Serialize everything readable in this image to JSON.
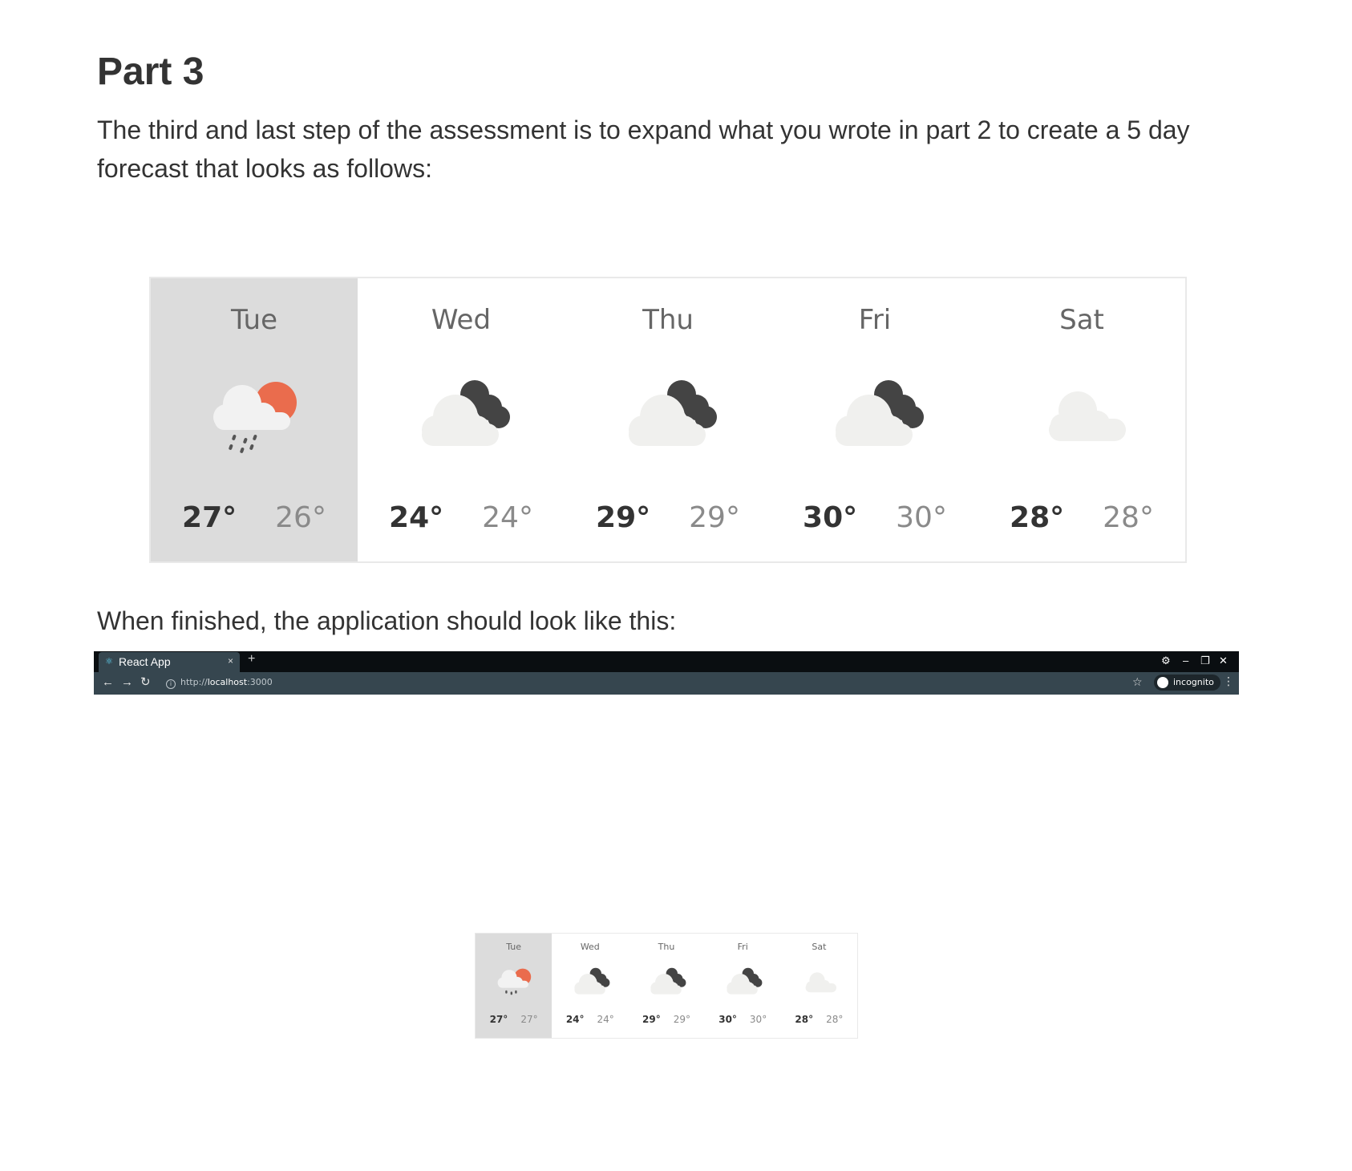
{
  "heading": "Part 3",
  "paragraph1": "The third and last step of the assessment is to expand what you wrote in part 2 to create a 5 day forecast that looks as follows:",
  "paragraph2": "When finished, the application should look like this:",
  "forecast": [
    {
      "day": "Tue",
      "high": "27°",
      "low": "26°",
      "icon": "sun-cloud-rain-icon",
      "selected": true
    },
    {
      "day": "Wed",
      "high": "24°",
      "low": "24°",
      "icon": "dark-cloud-icon",
      "selected": false
    },
    {
      "day": "Thu",
      "high": "29°",
      "low": "29°",
      "icon": "dark-cloud-icon",
      "selected": false
    },
    {
      "day": "Fri",
      "high": "30°",
      "low": "30°",
      "icon": "dark-cloud-icon",
      "selected": false
    },
    {
      "day": "Sat",
      "high": "28°",
      "low": "28°",
      "icon": "cloud-icon",
      "selected": false
    }
  ],
  "browser": {
    "tab_title": "React App",
    "tab_close": "×",
    "new_tab": "+",
    "url_scheme": "http://",
    "url_host": "localhost",
    "url_port": ":3000",
    "incognito_label": "incognito"
  },
  "small_forecast": [
    {
      "day": "Tue",
      "high": "27°",
      "low": "27°",
      "icon": "sun-cloud-rain-icon",
      "selected": true
    },
    {
      "day": "Wed",
      "high": "24°",
      "low": "24°",
      "icon": "dark-cloud-icon",
      "selected": false
    },
    {
      "day": "Thu",
      "high": "29°",
      "low": "29°",
      "icon": "dark-cloud-icon",
      "selected": false
    },
    {
      "day": "Fri",
      "high": "30°",
      "low": "30°",
      "icon": "dark-cloud-icon",
      "selected": false
    },
    {
      "day": "Sat",
      "high": "28°",
      "low": "28°",
      "icon": "cloud-icon",
      "selected": false
    }
  ],
  "colors": {
    "sun": "#ea6c4d",
    "dark_cloud": "#444444",
    "light_cloud": "#f0f0ee",
    "selected_bg": "#dcdcdc"
  }
}
